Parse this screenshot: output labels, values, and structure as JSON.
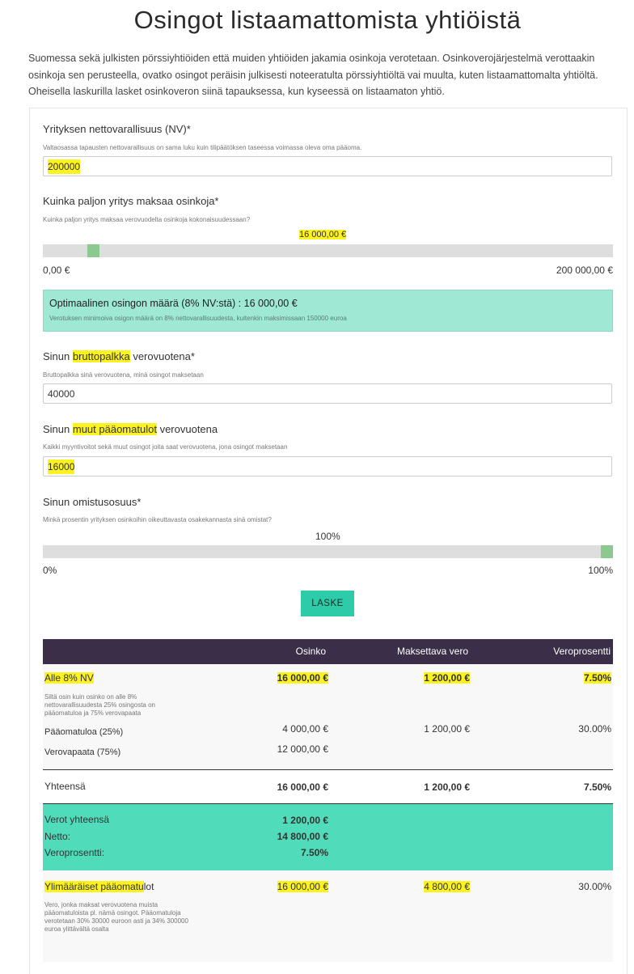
{
  "title": "Osingot listaamattomista yhtiöistä",
  "intro": "Suomessa sekä julkisten pörssiyhtiöiden että muiden yhtiöiden jakamia osinkoja verotetaan. Osinkoverojärjestelmä verottaakin osinkoja sen perusteella, ovatko osingot peräisin julkisesti noteeratulta pörssiyhtiöltä vai muulta, kuten listaamattomalta yhtiöltä. Oheisella laskurilla lasket osinkoveron siinä tapauksessa, kun kyseessä on listaamaton yhtiö.",
  "net_assets": {
    "label": "Yrityksen nettovarallisuus (NV)*",
    "hint": "Valtaosassa tapausten nettovarallisuus on sama luku kuin tilipäätöksen taseessa voimassa oleva oma pääoma.",
    "value": "200000"
  },
  "dividend": {
    "label": "Kuinka paljon yritys maksaa osinkoja*",
    "hint": "Kuinka paljon yritys maksaa verovuodelta osinkoja kokonaisuudessaan?",
    "value_label": "16 000,00 €",
    "fraction": 0.08,
    "min_label": "0,00 €",
    "max_label": "200 000,00 €"
  },
  "optimal": {
    "text": "Optimaalinen osingon määrä (8% NV:stä) : 16 000,00 €",
    "sub": "Verotuksen minimoiva osigon määrä on 8% nettovarallisuudesta, kuitenkin maksimissaan 150000 euroa"
  },
  "salary": {
    "label_pre": "Sinun ",
    "label_hl": "bruttopalkka",
    "label_post": " verovuotena*",
    "hint": "Bruttopalkka sinä verovuotena, minä osingot maksetaan",
    "value": "40000"
  },
  "capital": {
    "label_pre": "Sinun ",
    "label_hl": "muut pääomatulot",
    "label_post": " verovuotena",
    "hint": "Kaikki myyntivoitot sekä muut osingot joita saat verovuotena, jona osingot maksetaan",
    "value": "16000"
  },
  "ownership": {
    "label": "Sinun omistusosuus*",
    "hint": "Minkä prosentin yrityksen osinkoihin oikeuttavasta osakekannasta sinä omistat?",
    "value_label": "100%",
    "fraction": 1.0,
    "min_label": "0%",
    "max_label": "100%"
  },
  "calc_button": "LASKE",
  "table": {
    "headers": [
      "Osinko",
      "Maksettava vero",
      "Veroprosentti"
    ],
    "under8": {
      "label": "Alle 8% NV",
      "osinko": "16 000,00 €",
      "vero": "1 200,00 €",
      "pct": "7.50%",
      "note": "Siltä osin kuin osinko on alle 8% nettovarallisuudesta 25% osingosta on pääomatuloa ja 75% verovapaata"
    },
    "capital_row": {
      "label": "Pääomatuloa (25%)",
      "osinko": "4 000,00 €",
      "vero": "1 200,00 €",
      "pct": "30.00%"
    },
    "taxfree_row": {
      "label": "Verovapaata (75%)",
      "osinko": "12 000,00 €"
    },
    "total_row": {
      "label": "Yhteensä",
      "osinko": "16 000,00 €",
      "vero": "1 200,00 €",
      "pct": "7.50%"
    },
    "summary": {
      "tax_label": "Verot yhteensä",
      "tax_value": "1 200,00 €",
      "net_label": "Netto:",
      "net_value": "14 800,00 €",
      "pct_label": "Veroprosentti:",
      "pct_value": "7.50%"
    },
    "extra": {
      "label_hl": "Ylimääräiset pääomatu",
      "label_rest": "lot",
      "osinko": "16 000,00 €",
      "vero": "4 800,00 €",
      "pct": "30.00%",
      "note": "Vero, jonka maksat verovuotena muista pääomatuloista pl. nämä osingot. Pääomatuloja verotetaan 30% 30000 euroon asti ja 34% 300000 euroa ylittävältä osalta"
    }
  },
  "colors": {
    "accent": "#2ecba8",
    "header_bg": "#3b2e48",
    "highlight": "#fbf21f",
    "summary_bg": "#50dcbb",
    "info_bg": "#9ee8d4"
  }
}
